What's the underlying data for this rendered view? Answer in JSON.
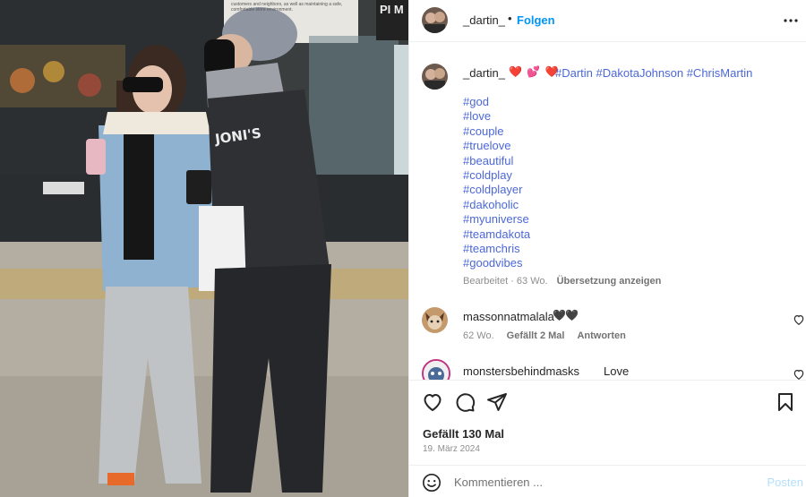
{
  "post": {
    "username": "_dartin_",
    "follow_label": "Folgen",
    "caption": {
      "username": "_dartin_",
      "emojis": "❤️ 💕 ❤️",
      "inline_tags": "#Dartin #DakotaJohnson #ChrisMartin",
      "hashtags": [
        "#god",
        "#love",
        "#couple",
        "#truelove",
        "#beautiful",
        "#coldplay",
        "#coldplayer",
        "#dakoholic",
        "#myuniverse",
        "#teamdakota",
        "#teamchris",
        "#goodvibes"
      ],
      "edited": "Bearbeitet · 63 Wo.",
      "translate_label": "Übersetzung anzeigen"
    },
    "comments": [
      {
        "username": "massonnatmalala",
        "text": "🖤🖤",
        "age": "62 Wo.",
        "likes": "Gefällt 2 Mal",
        "reply_label": "Antworten"
      },
      {
        "username": "monstersbehindmasks",
        "text": "Love"
      }
    ],
    "likes_text": "Gefällt 130 Mal",
    "date": "19. März 2024",
    "comment_placeholder": "Kommentieren ...",
    "post_label": "Posten",
    "photo": {
      "sign_text": "customers and neighbors, as well as maintaining a safe, comfortable store environment.",
      "sweatshirt_text": "JONI'S",
      "store_sign": "PI M"
    },
    "icons": {
      "more": "more-options-icon",
      "like": "heart-icon",
      "comment": "comment-icon",
      "share": "share-icon",
      "save": "bookmark-icon",
      "emoji": "emoji-icon"
    },
    "colors": {
      "link": "#0095f6",
      "hashtag": "#4c68d7",
      "muted": "#8e8e8e",
      "post_disabled": "#b2dffc"
    }
  }
}
